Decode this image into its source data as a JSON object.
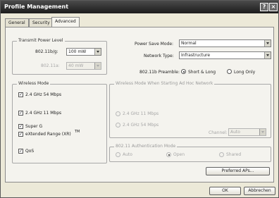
{
  "window": {
    "title": "Profile Management",
    "help_button": "?",
    "close_button": "×"
  },
  "tabs": [
    {
      "label": "General"
    },
    {
      "label": "Security"
    },
    {
      "label": "Advanced"
    }
  ],
  "transmit": {
    "legend": "Transmit Power Level",
    "b_label": "802.11b/g:",
    "b_value": "100 mW",
    "a_label": "802.11a:",
    "a_value": "40 mW"
  },
  "right_top": {
    "power_save_label": "Power Save Mode:",
    "power_save_value": "Normal",
    "network_type_label": "Network Type:",
    "network_type_value": "Infrastructure",
    "preamble_label": "802.11b Preamble:",
    "preamble_short_long": "Short & Long",
    "preamble_long_only": "Long Only"
  },
  "wireless_mode": {
    "legend": "Wireless Mode",
    "item1": "2.4 GHz 54 Mbps",
    "item2": "2.4 GHz 11 Mbps",
    "item3": "Super G",
    "item4": "eXtended Range (XR)",
    "tm": "TM",
    "item5": "QoS"
  },
  "adhoc": {
    "legend": "Wireless Mode When Starting Ad Hoc Network",
    "opt1": "2.4 GHz 11 Mbps",
    "opt2": "2.4 GHz 54 Mbps",
    "channel_label": "Channel:",
    "channel_value": "Auto"
  },
  "auth": {
    "legend": "802.11 Authentication Mode",
    "auto": "Auto",
    "open": "Open",
    "shared": "Shared"
  },
  "preferred_aps_button": "Preferred APs...",
  "ok_button": "OK",
  "cancel_button": "Abbrechen"
}
